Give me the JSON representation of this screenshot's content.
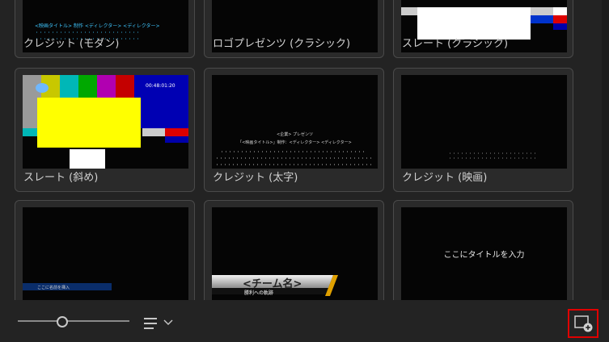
{
  "cards": [
    {
      "label": "クレジット (モダン)"
    },
    {
      "label": "ロゴプレゼンツ (クラシック)"
    },
    {
      "label": "スレート (クラシック)"
    },
    {
      "label": "スレート (斜め)"
    },
    {
      "label": "クレジット (太字)"
    },
    {
      "label": "クレジット (映画)"
    },
    {
      "label": ""
    },
    {
      "label": ""
    },
    {
      "label": ""
    }
  ],
  "thumbs": {
    "modern_line1": "<映画タイトル> 制作 <ディレクター> <ディレクター>",
    "slate_time": "00:48:01:20",
    "bold_presents": "<企業> プレゼンツ",
    "bold_title": "「<映画タイトル>」制作：<ディレクター> <ディレクター>",
    "lower_third_text": "ここに名前を挿入",
    "team_name": "<チーム名>",
    "team_sub": "勝利への軌跡",
    "title_text": "ここにタイトルを入力"
  },
  "toolbar": {
    "zoom_slider_level": 0.4,
    "sort_icon": "list-sort-icon",
    "new_item_icon": "new-item-icon"
  },
  "colors": {
    "background": "#232323",
    "card_border": "#4a4a4a",
    "highlight": "#e00000"
  }
}
